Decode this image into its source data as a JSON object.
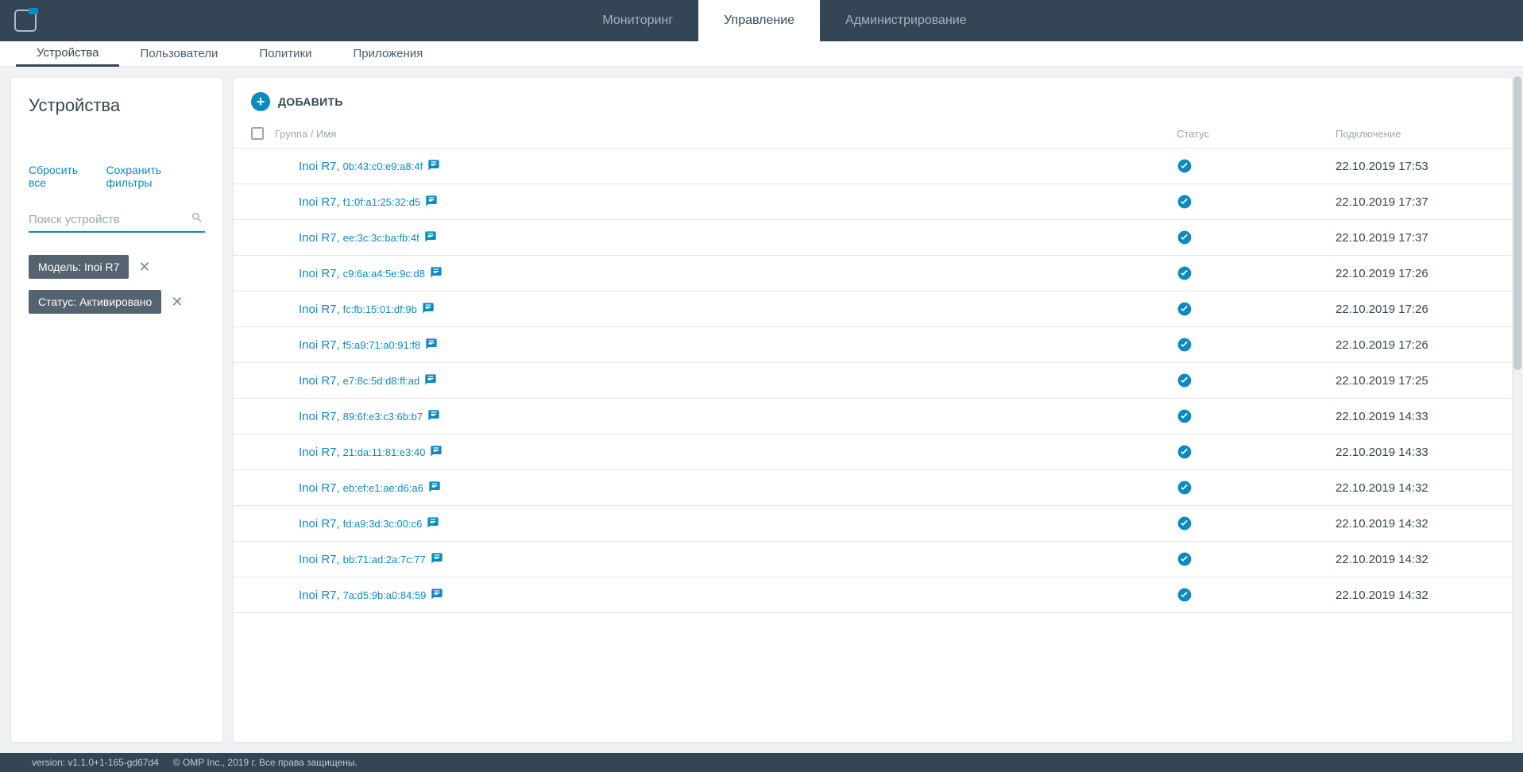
{
  "topnav": [
    {
      "label": "Мониторинг",
      "active": false
    },
    {
      "label": "Управление",
      "active": true
    },
    {
      "label": "Администрирование",
      "active": false
    }
  ],
  "subnav": [
    {
      "label": "Устройства",
      "active": true
    },
    {
      "label": "Пользователи",
      "active": false
    },
    {
      "label": "Политики",
      "active": false
    },
    {
      "label": "Приложения",
      "active": false
    }
  ],
  "sidebar": {
    "title": "Устройства",
    "reset": "Сбросить все",
    "save": "Сохранить фильтры",
    "search_placeholder": "Поиск устройств",
    "chips": [
      {
        "label": "Модель: Inoi R7"
      },
      {
        "label": "Статус: Активировано"
      }
    ]
  },
  "content": {
    "add_label": "ДОБАВИТЬ",
    "columns": {
      "name": "Группа / Имя",
      "status": "Статус",
      "conn": "Подключение"
    },
    "rows": [
      {
        "dev": "Inoi R7",
        "mac": "0b:43:c0:e9:a8:4f",
        "conn": "22.10.2019 17:53"
      },
      {
        "dev": "Inoi R7",
        "mac": "f1:0f:a1:25:32:d5",
        "conn": "22.10.2019 17:37"
      },
      {
        "dev": "Inoi R7",
        "mac": "ee:3c:3c:ba:fb:4f",
        "conn": "22.10.2019 17:37"
      },
      {
        "dev": "Inoi R7",
        "mac": "c9:6a:a4:5e:9c:d8",
        "conn": "22.10.2019 17:26"
      },
      {
        "dev": "Inoi R7",
        "mac": "fc:fb:15:01:df:9b",
        "conn": "22.10.2019 17:26"
      },
      {
        "dev": "Inoi R7",
        "mac": "f5:a9:71:a0:91:f8",
        "conn": "22.10.2019 17:26"
      },
      {
        "dev": "Inoi R7",
        "mac": "e7:8c:5d:d8:ff:ad",
        "conn": "22.10.2019 17:25"
      },
      {
        "dev": "Inoi R7",
        "mac": "89:6f:e3:c3:6b:b7",
        "conn": "22.10.2019 14:33"
      },
      {
        "dev": "Inoi R7",
        "mac": "21:da:11:81:e3:40",
        "conn": "22.10.2019 14:33"
      },
      {
        "dev": "Inoi R7",
        "mac": "eb:ef:e1:ae:d6:a6",
        "conn": "22.10.2019 14:32"
      },
      {
        "dev": "Inoi R7",
        "mac": "fd:a9:3d:3c:00:c6",
        "conn": "22.10.2019 14:32"
      },
      {
        "dev": "Inoi R7",
        "mac": "bb:71:ad:2a:7c:77",
        "conn": "22.10.2019 14:32"
      },
      {
        "dev": "Inoi R7",
        "mac": "7a:d5:9b:a0:84:59",
        "conn": "22.10.2019 14:32"
      }
    ]
  },
  "footer": {
    "version": "version: v1.1.0+1-165-gd67d4",
    "copyright": "© OMP Inc., 2019 г. Все права защищены."
  }
}
